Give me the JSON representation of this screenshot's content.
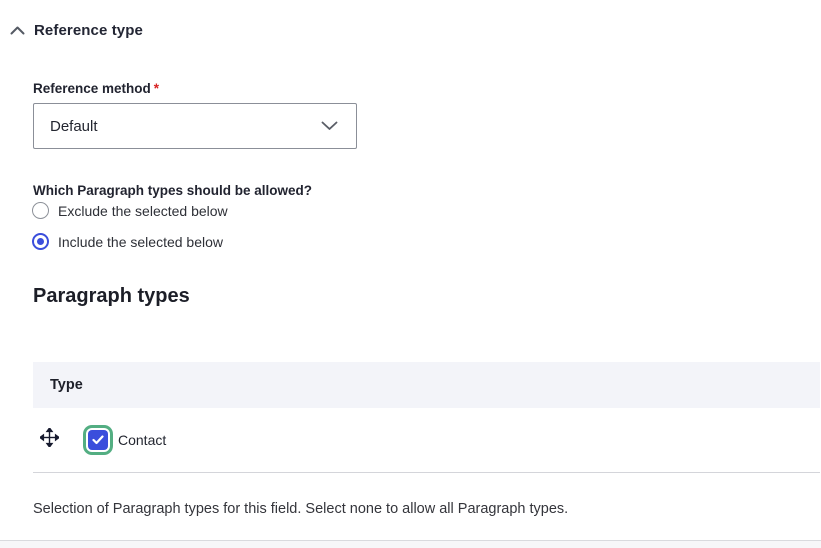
{
  "section": {
    "title": "Reference type"
  },
  "reference_method": {
    "label": "Reference method",
    "required_marker": "*",
    "value": "Default"
  },
  "allowed_types": {
    "question": "Which Paragraph types should be allowed?",
    "options": [
      {
        "label": "Exclude the selected below",
        "selected": false
      },
      {
        "label": "Include the selected below",
        "selected": true
      }
    ]
  },
  "paragraph_types": {
    "heading": "Paragraph types",
    "table": {
      "columns": [
        "Type"
      ],
      "rows": [
        {
          "type": "Contact",
          "checked": true
        }
      ]
    },
    "description": "Selection of Paragraph types for this field. Select none to allow all Paragraph types."
  },
  "icons": {
    "collapse": "chevron-up-icon",
    "select": "chevron-down-icon",
    "row_drag": "drag-handle-icon",
    "checkbox": "checkmark-icon"
  },
  "colors": {
    "accent_blue": "#3b4edc",
    "focus_green": "#53ae82",
    "required_red": "#d72222",
    "table_header_bg": "#f3f4f9",
    "border_gray": "#8b8f98"
  }
}
